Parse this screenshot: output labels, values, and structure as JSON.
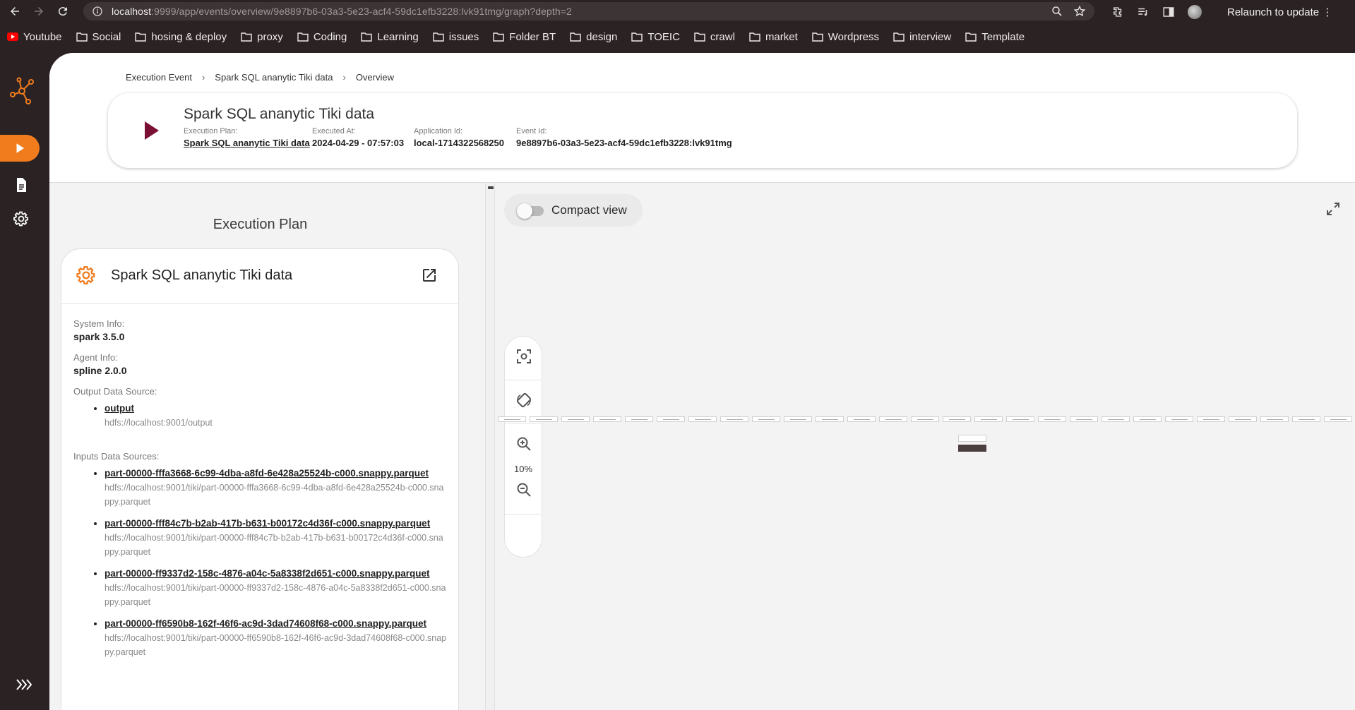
{
  "browser": {
    "url_host": "localhost",
    "url_rest": ":9999/app/events/overview/9e8897b6-03a3-5e23-acf4-59dc1efb3228:lvk91tmg/graph?depth=2",
    "relaunch_label": "Relaunch to update"
  },
  "bookmarks": [
    "Youtube",
    "Social",
    "hosing & deploy",
    "proxy",
    "Coding",
    "Learning",
    "issues",
    "Folder BT",
    "design",
    "TOEIC",
    "crawl",
    "market",
    "Wordpress",
    "interview",
    "Template"
  ],
  "breadcrumb": [
    "Execution Event",
    "Spark SQL ananytic Tiki data",
    "Overview"
  ],
  "summary": {
    "title": "Spark SQL ananytic Tiki data",
    "execution_plan_label": "Execution Plan:",
    "execution_plan_value": "Spark SQL ananytic Tiki data",
    "executed_at_label": "Executed At:",
    "executed_at_value": "2024-04-29 - 07:57:03",
    "application_id_label": "Application Id:",
    "application_id_value": "local-1714322568250",
    "event_id_label": "Event Id:",
    "event_id_value": "9e8897b6-03a3-5e23-acf4-59dc1efb3228:lvk91tmg"
  },
  "plan": {
    "heading": "Execution Plan",
    "card_title": "Spark SQL ananytic Tiki data",
    "system_info_label": "System Info:",
    "system_info_value": "spark 3.5.0",
    "agent_info_label": "Agent Info:",
    "agent_info_value": "spline 2.0.0",
    "output_label": "Output Data Source:",
    "output_name": "output",
    "output_uri": "hdfs://localhost:9001/output",
    "inputs_label": "Inputs Data Sources:",
    "inputs": [
      {
        "name": "part-00000-fffa3668-6c99-4dba-a8fd-6e428a25524b-c000.snappy.parquet",
        "uri": "hdfs://localhost:9001/tiki/part-00000-fffa3668-6c99-4dba-a8fd-6e428a25524b-c000.snappy.parquet"
      },
      {
        "name": "part-00000-fff84c7b-b2ab-417b-b631-b00172c4d36f-c000.snappy.parquet",
        "uri": "hdfs://localhost:9001/tiki/part-00000-fff84c7b-b2ab-417b-b631-b00172c4d36f-c000.snappy.parquet"
      },
      {
        "name": "part-00000-ff9337d2-158c-4876-a04c-5a8338f2d651-c000.snappy.parquet",
        "uri": "hdfs://localhost:9001/tiki/part-00000-ff9337d2-158c-4876-a04c-5a8338f2d651-c000.snappy.parquet"
      },
      {
        "name": "part-00000-ff6590b8-162f-46f6-ac9d-3dad74608f68-c000.snappy.parquet",
        "uri": "hdfs://localhost:9001/tiki/part-00000-ff6590b8-162f-46f6-ac9d-3dad74608f68-c000.snappy.parquet"
      }
    ]
  },
  "graph": {
    "compact_view_label": "Compact view",
    "compact_view_enabled": false,
    "zoom_level": "10%"
  },
  "colors": {
    "accent": "#f07c1e",
    "play": "#7a1034",
    "sidebar": "#2b2223"
  }
}
